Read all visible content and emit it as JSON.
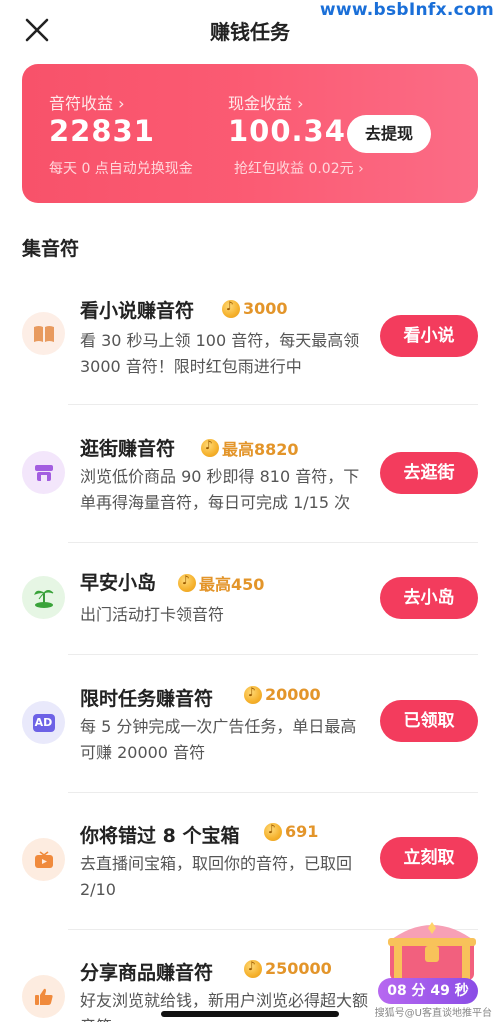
{
  "watermark_top": "www.bsbInfx.com",
  "header": {
    "title": "赚钱任务"
  },
  "earnings": {
    "note_label": "音符收益 ›",
    "note_value": "22831",
    "note_sub": "每天 0 点自动兑换现金",
    "cash_label": "现金收益 ›",
    "cash_value": "100.34",
    "cash_sub": "抢红包收益 0.02元 ›",
    "withdraw_label": "去提现"
  },
  "section_title": "集音符",
  "tasks": [
    {
      "title": "看小说赚音符",
      "reward": "3000",
      "desc": "看 30 秒马上领 100 音符，每天最高领 3000 音符！限时红包雨进行中",
      "button": "看小说",
      "icon": "book-icon"
    },
    {
      "title": "逛街赚音符",
      "reward": "最高8820",
      "desc": "浏览低价商品 90 秒即得 810 音符，下单再得海量音符，每日可完成 1/15 次",
      "button": "去逛街",
      "icon": "store-icon"
    },
    {
      "title": "早安小岛",
      "reward": "最高450",
      "desc": "出门活动打卡领音符",
      "button": "去小岛",
      "icon": "island-icon"
    },
    {
      "title": "限时任务赚音符",
      "reward": "20000",
      "desc": "每 5 分钟完成一次广告任务，单日最高可赚 20000 音符",
      "button": "已领取",
      "icon": "ad-icon",
      "icon_text": "AD"
    },
    {
      "title": "你将错过 8 个宝箱",
      "reward": "691",
      "desc": "去直播间宝箱，取回你的音符，已取回 2/10",
      "button": "立刻取",
      "icon": "live-tv-icon"
    },
    {
      "title": "分享商品赚音符",
      "reward": "250000",
      "desc": "好友浏览就给钱，新用户浏览必得超大额音符",
      "icon": "thumbs-up-icon"
    }
  ],
  "chest_timer": "08 分 49 秒",
  "watermark_bottom": "搜狐号@U客直谈地推平台",
  "colors": {
    "accent": "#f33c5d",
    "card": "#f8526a",
    "reward": "#e3952a"
  }
}
